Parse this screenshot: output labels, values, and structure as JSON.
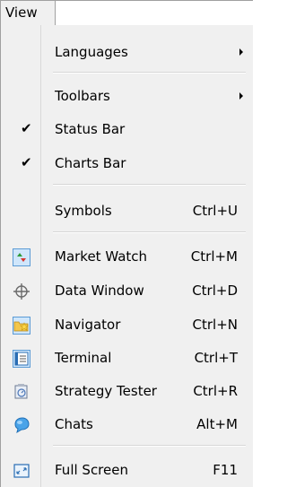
{
  "menubar": {
    "active_menu": "View"
  },
  "menu": {
    "languages": {
      "label": "Languages"
    },
    "toolbars": {
      "label": "Toolbars"
    },
    "status_bar": {
      "label": "Status Bar",
      "checked": true
    },
    "charts_bar": {
      "label": "Charts Bar",
      "checked": true
    },
    "symbols": {
      "label": "Symbols",
      "shortcut": "Ctrl+U"
    },
    "market_watch": {
      "label": "Market Watch",
      "shortcut": "Ctrl+M",
      "icon": "market-watch-icon"
    },
    "data_window": {
      "label": "Data Window",
      "shortcut": "Ctrl+D",
      "icon": "crosshair-icon"
    },
    "navigator": {
      "label": "Navigator",
      "shortcut": "Ctrl+N",
      "icon": "folder-star-icon"
    },
    "terminal": {
      "label": "Terminal",
      "shortcut": "Ctrl+T",
      "icon": "terminal-icon"
    },
    "strategy_tester": {
      "label": "Strategy Tester",
      "shortcut": "Ctrl+R",
      "icon": "tester-icon"
    },
    "chats": {
      "label": "Chats",
      "shortcut": "Alt+M",
      "icon": "chat-bubble-icon"
    },
    "full_screen": {
      "label": "Full Screen",
      "shortcut": "F11",
      "icon": "full-screen-icon"
    }
  },
  "colors": {
    "menu_bg": "#f0f0f0",
    "icon_highlight": "#cfe6fb",
    "icon_border": "#5b9bd5"
  }
}
